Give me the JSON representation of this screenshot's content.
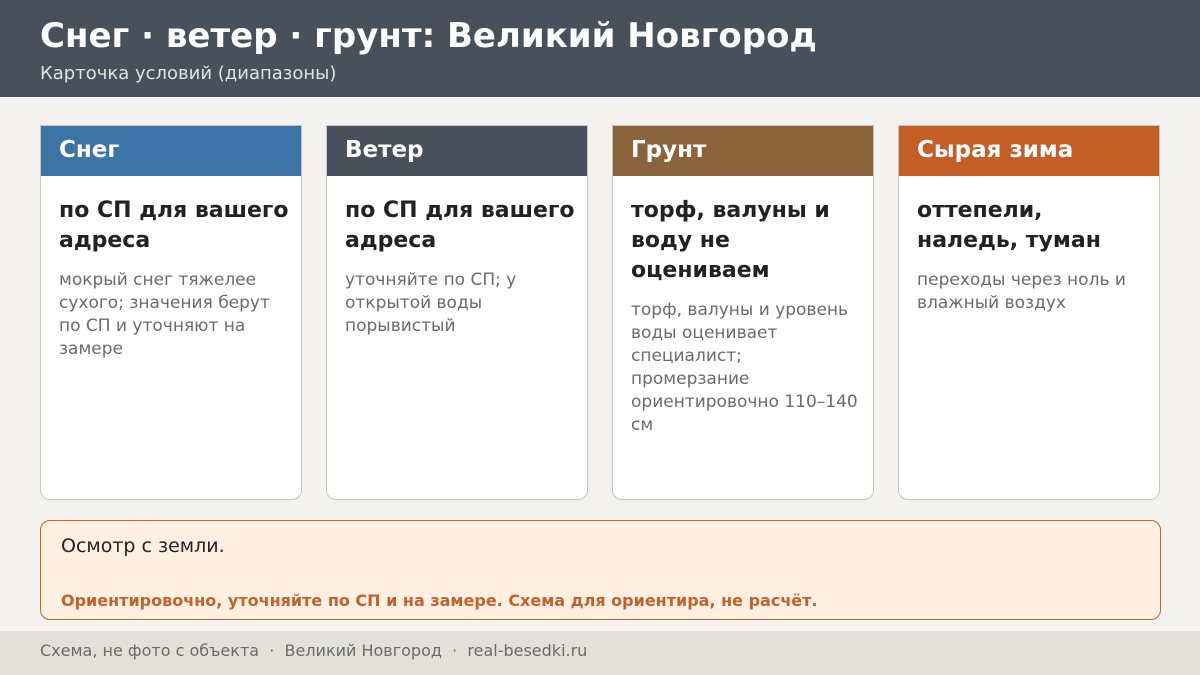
{
  "header": {
    "title": "Снег · ветер · грунт: Великий Новгород",
    "subtitle": "Карточка условий (диапазоны)"
  },
  "cards": [
    {
      "title": "Снег",
      "color": "#3d74a8",
      "main": "по СП для вашего адреса",
      "note": "мокрый снег тяжелее сухого; значения берут по СП и уточняют на замере"
    },
    {
      "title": "Ветер",
      "color": "#48505b",
      "main": "по СП для вашего адреса",
      "note": "уточняйте по СП; у открытой воды порывистый"
    },
    {
      "title": "Грунт",
      "color": "#8b643c",
      "main": "торф, валуны и воду не оцениваем",
      "note": "торф, валуны и уровень воды оценивает специалист; промерзание ориентировочно 110–140 см"
    },
    {
      "title": "Сырая зима",
      "color": "#c55d27",
      "main": "оттепели, наледь, туман",
      "note": "переходы через ноль и влажный воздух"
    }
  ],
  "note_box": {
    "text": "Осмотр с земли.",
    "warning": "Ориентировочно, уточняйте по СП и на замере. Схема для ориентира, не расчёт."
  },
  "footer": {
    "text": "Схема, не фото с объекта  ·  Великий Новгород  ·  real-besedki.ru"
  }
}
